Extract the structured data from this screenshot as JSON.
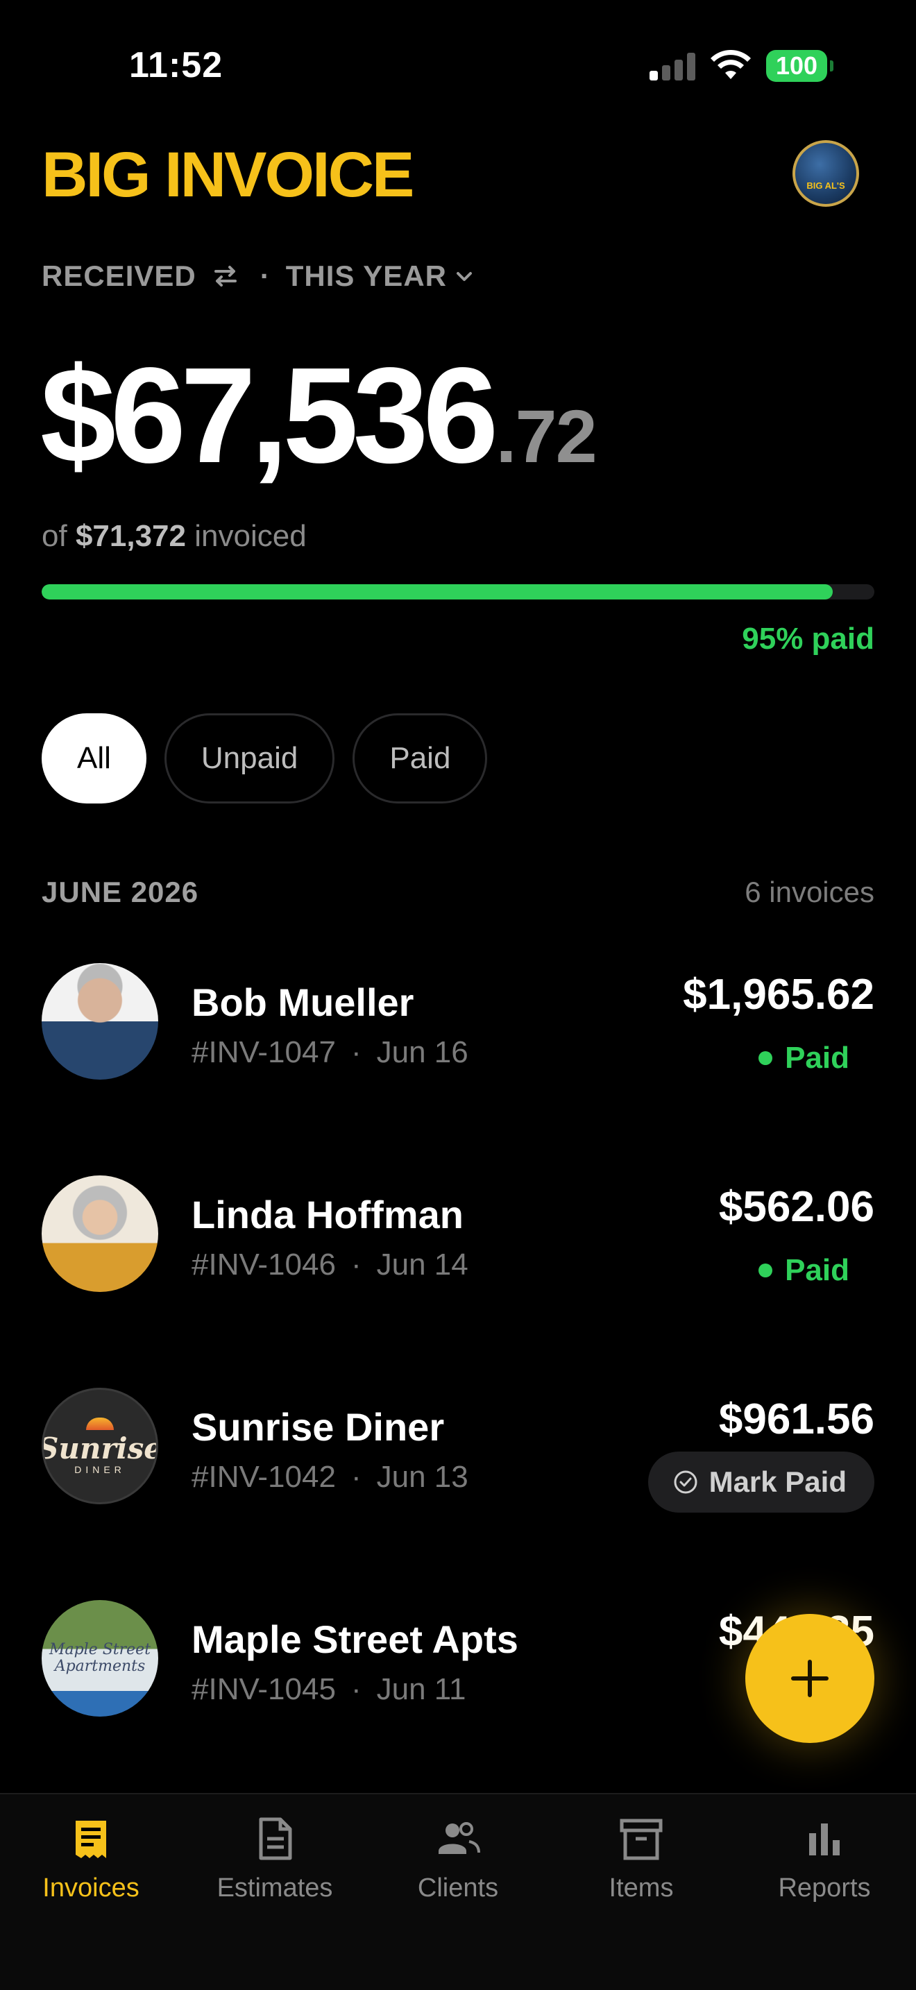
{
  "status_bar": {
    "time": "11:52",
    "battery": "100"
  },
  "header": {
    "app_title": "BIG INVOICE",
    "brand_logo_text": "BIG AL'S"
  },
  "summary": {
    "filter_received": "RECEIVED",
    "filter_sep": "·",
    "filter_period": "THIS YEAR",
    "amount_whole": "$67,536",
    "amount_cents": ".72",
    "invoiced_prefix": "of",
    "invoiced_amount": "$71,372",
    "invoiced_suffix": "invoiced",
    "paid_fraction": 0.95,
    "paid_label": "95% paid"
  },
  "segments": [
    {
      "label": "All",
      "active": true
    },
    {
      "label": "Unpaid",
      "active": false
    },
    {
      "label": "Paid",
      "active": false
    }
  ],
  "section": {
    "month": "JUNE 2026",
    "count": "6 invoices"
  },
  "invoices": [
    {
      "name": "Bob Mueller",
      "number": "#INV-1047",
      "sep": "·",
      "date": "Jun 16",
      "amount": "$1,965.62",
      "status": "Paid"
    },
    {
      "name": "Linda Hoffman",
      "number": "#INV-1046",
      "sep": "·",
      "date": "Jun 14",
      "amount": "$562.06",
      "status": "Paid"
    },
    {
      "name": "Sunrise Diner",
      "number": "#INV-1042",
      "sep": "·",
      "date": "Jun 13",
      "amount": "$961.56",
      "action": "Mark Paid",
      "logo_text": "Sunrise",
      "logo_sub": "DINER"
    },
    {
      "name": "Maple Street Apts",
      "number": "#INV-1045",
      "sep": "·",
      "date": "Jun 11",
      "amount": "$440.35",
      "logo_text": "Maple Street Apartments"
    }
  ],
  "tabs": [
    {
      "label": "Invoices",
      "icon": "invoices-icon",
      "active": true
    },
    {
      "label": "Estimates",
      "icon": "estimates-icon",
      "active": false
    },
    {
      "label": "Clients",
      "icon": "clients-icon",
      "active": false
    },
    {
      "label": "Items",
      "icon": "items-icon",
      "active": false
    },
    {
      "label": "Reports",
      "icon": "reports-icon",
      "active": false
    }
  ],
  "colors": {
    "accent": "#f6c11a",
    "success": "#2fd15a",
    "background": "#000000"
  }
}
